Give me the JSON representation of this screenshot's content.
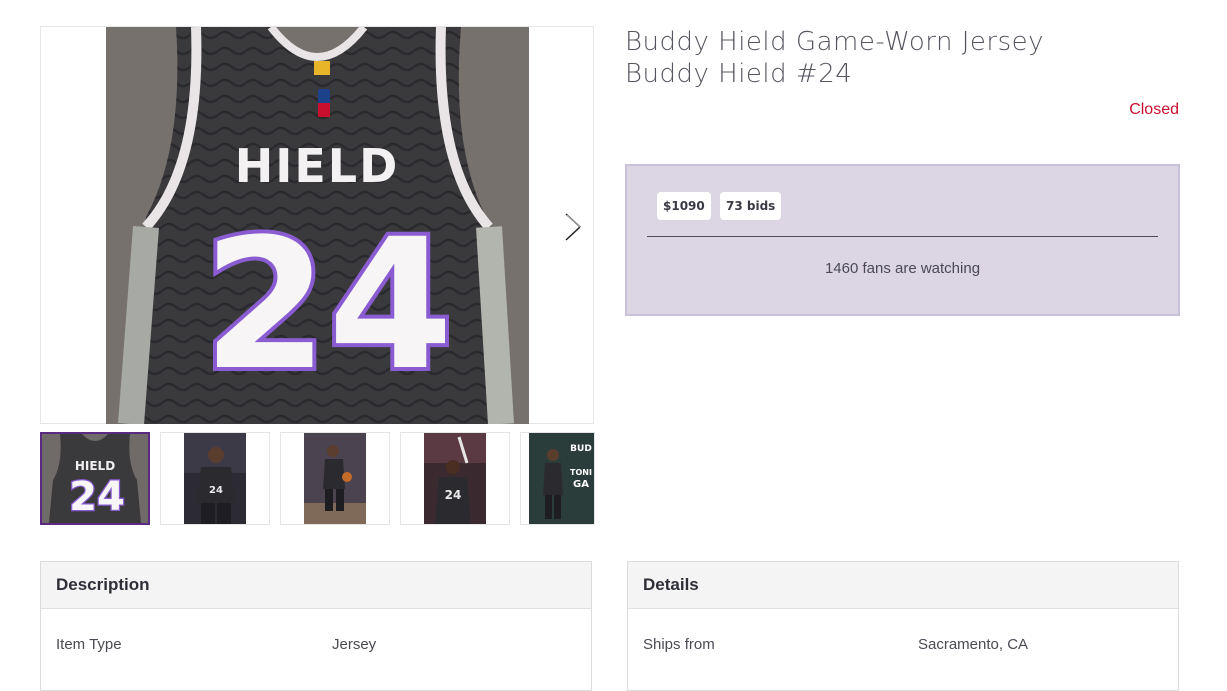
{
  "listing": {
    "title": "Buddy Hield Game-Worn Jersey",
    "subtitle": "Buddy Hield #24",
    "status": "Closed"
  },
  "gallery": {
    "main_image": {
      "name_on_jersey": "HIELD",
      "number_on_jersey": "24"
    },
    "thumbs": [
      {
        "label": "HIELD",
        "number": "24"
      },
      {
        "label": "",
        "number": "24"
      },
      {
        "label": "",
        "number": ""
      },
      {
        "label": "",
        "number": "24"
      },
      {
        "label": "BUD TONI GA",
        "number": ""
      }
    ]
  },
  "bidding": {
    "price": "$1090",
    "bids": "73 bids",
    "watching": "1460 fans are watching"
  },
  "description": {
    "heading": "Description",
    "rows": [
      {
        "label": "Item Type",
        "value": "Jersey"
      }
    ]
  },
  "details": {
    "heading": "Details",
    "rows": [
      {
        "label": "Ships from",
        "value": "Sacramento, CA"
      }
    ]
  },
  "colors": {
    "accent": "#5a2a82",
    "status": "#c8102e",
    "bid_box": "#dcd6e4"
  },
  "icons": {
    "next": "chevron-right-icon"
  }
}
